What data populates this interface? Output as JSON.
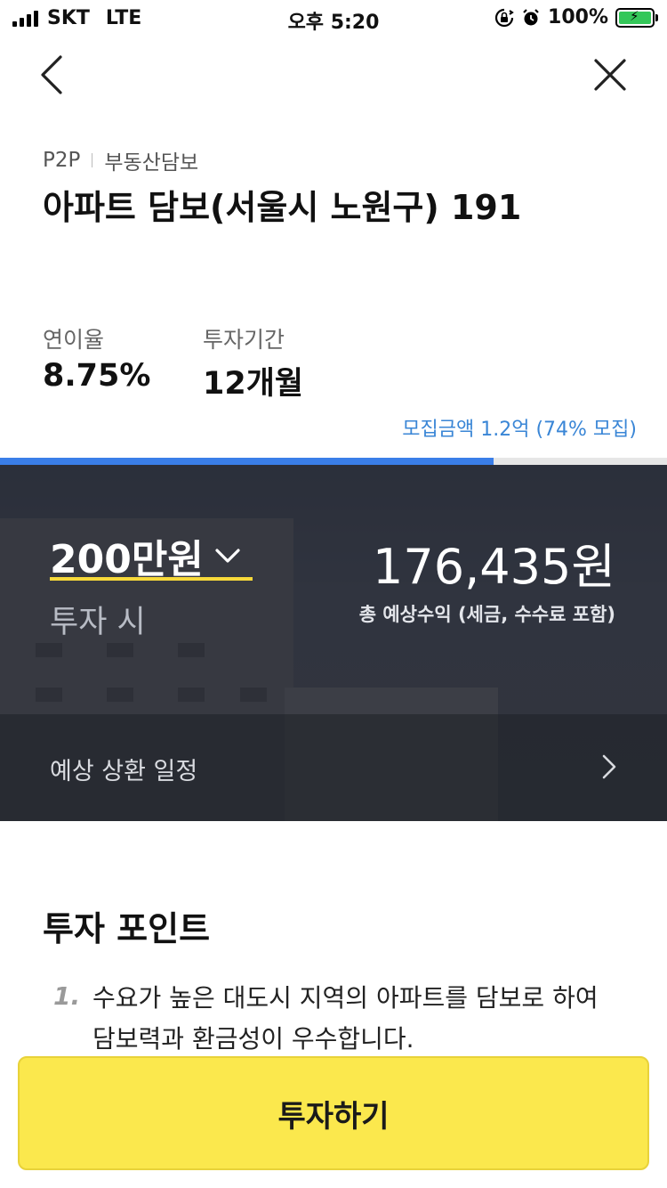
{
  "status_bar": {
    "carrier": "SKT",
    "network": "LTE",
    "time": "오후 5:20",
    "battery": "100%",
    "battery_level": 1.0
  },
  "header": {
    "category": "P2P",
    "subcategory": "부동산담보",
    "title": "아파트 담보(서울시 노원구) 191"
  },
  "stats": {
    "rate_label": "연이율",
    "rate_value": "8.75%",
    "period_label": "투자기간",
    "period_value": "12개월"
  },
  "recruitment": {
    "text": "모집금액 1.2억 (74% 모집)",
    "progress": 0.74,
    "accent": "#3a7ee8"
  },
  "calculator": {
    "amount": "200만원",
    "amount_caption": "투자 시",
    "expected_profit": "176,435원",
    "profit_note": "총 예상수익 (세금, 수수료 포함)",
    "schedule_label": "예상 상환 일정"
  },
  "points": {
    "title": "투자 포인트",
    "items": [
      {
        "number": "1.",
        "text": "수요가 높은 대도시 지역의 아파트를 담보로 하여 담보력과 환금성이 우수합니다."
      }
    ]
  },
  "cta": {
    "label": "투자하기",
    "color": "#fbe84d"
  },
  "icons": {
    "back": "chevron-left-icon",
    "close": "close-icon",
    "dropdown": "chevron-down-icon",
    "schedule": "chevron-right-icon"
  }
}
